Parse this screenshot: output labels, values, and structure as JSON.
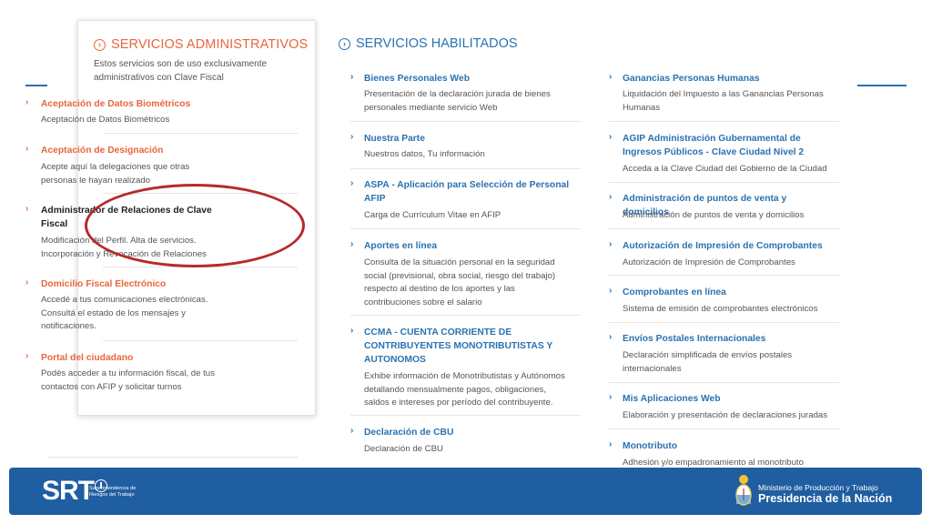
{
  "colors": {
    "accent_orange": "#e8663c",
    "accent_blue": "#2b72b0",
    "highlight_red": "#b52a2a",
    "footer_blue": "#1f5ea0"
  },
  "admin": {
    "title": "SERVICIOS ADMINISTRATIVOS",
    "description": "Estos servicios son de uso exclusivamente administrativos con Clave Fiscal",
    "items": [
      {
        "title": "Aceptación de Datos Biométricos",
        "desc": "Aceptación de Datos Biométricos"
      },
      {
        "title": "Aceptación de Designación",
        "desc": "Acepte aquí la delegaciones que otras personas le hayan realizado"
      },
      {
        "title": "Administrador de Relaciones de Clave Fiscal",
        "desc": "Modificación del Perfil. Alta de servicios. Incorporación y Revocación de Relaciones"
      },
      {
        "title": "Domicilio Fiscal Electrónico",
        "desc": "Accedé a tus comunicaciones electrónicas. Consultá el estado de los mensajes y notificaciones."
      },
      {
        "title": "Portal del ciudadano",
        "desc": "Podés acceder a tu información fiscal, de tus contactos con AFIP y solicitar turnos"
      }
    ]
  },
  "services": {
    "title": "SERVICIOS HABILITADOS",
    "col1": [
      {
        "title": "Bienes Personales Web",
        "desc": "Presentación de la declaración jurada de bienes personales mediante servicio Web"
      },
      {
        "title": "Nuestra Parte",
        "desc": "Nuestros datos, Tu información"
      },
      {
        "title": "ASPA - Aplicación para Selección de Personal AFIP",
        "desc": "Carga de Currículum Vitae en AFIP"
      },
      {
        "title": "Aportes en línea",
        "desc": "Consulta de la situación personal en la seguridad social (previsional, obra social, riesgo del trabajo) respecto al destino de los aportes y las contribuciones sobre el salario"
      },
      {
        "title": "CCMA - CUENTA CORRIENTE DE CONTRIBUYENTES MONOTRIBUTISTAS Y AUTONOMOS",
        "desc": "Exhibe información de Monotributistas y Autónomos detallando mensualmente pagos, obligaciones, saldos e intereses por período del contribuyente."
      },
      {
        "title": "Declaración de CBU",
        "desc": "Declaración de CBU"
      }
    ],
    "col2": [
      {
        "title": "Ganancias Personas Humanas",
        "desc": "Liquidación del Impuesto a las Ganancias Personas Humanas"
      },
      {
        "title": "AGIP Administración Gubernamental de Ingresos Públicos - Clave Ciudad Nivel 2",
        "desc": "Acceda a la Clave Ciudad del Gobierno de la Ciudad"
      },
      {
        "title": "Administración de puntos de venta y domicilios",
        "desc": "Administración de puntos de venta y domicilios"
      },
      {
        "title": "Autorización de Impresión de Comprobantes",
        "desc": "Autorización de Impresión de Comprobantes"
      },
      {
        "title": "Comprobantes en línea",
        "desc": "Sistema de emisión de comprobantes electrónicos"
      },
      {
        "title": "Envíos Postales Internacionales",
        "desc": "Declaración simplificada de envíos postales internacionales"
      },
      {
        "title": "Mis Aplicaciones Web",
        "desc": "Elaboración y presentación de declaraciones juradas"
      },
      {
        "title": "Monotributo",
        "desc": "Adhesión y/o empadronamiento al monotributo"
      }
    ]
  },
  "footer": {
    "srt_logo": "SRT",
    "srt_subtitle": "Superintendencia de Riesgos del Trabajo",
    "ministry": "Ministerio de Producción y Trabajo",
    "presidency": "Presidencia de la Nación"
  },
  "icons": {
    "section_header": "circle-chevron-right-icon",
    "item_bullet": "chevron-right-icon",
    "footer_emblem": "coat-of-arms-icon"
  }
}
